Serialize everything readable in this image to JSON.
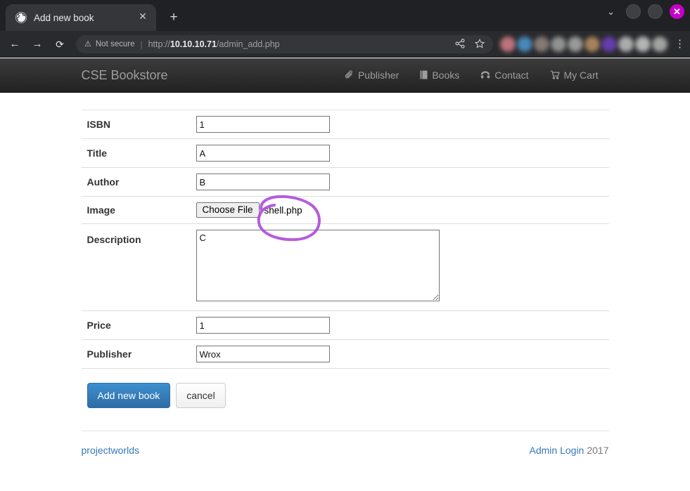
{
  "browser": {
    "tab": {
      "title": "Add new book",
      "favicon_icon": "globe-icon",
      "close_icon": "✕"
    },
    "new_tab_icon": "+",
    "window_controls": {
      "chevron_icon": "⌄",
      "minimize_icon": "",
      "maximize_icon": "",
      "close_icon": "✕"
    },
    "toolbar": {
      "back_icon": "←",
      "forward_icon": "→",
      "reload_icon": "⟳",
      "security_icon": "⚠",
      "security_label": "Not secure",
      "separator": "|",
      "url_scheme": "http://",
      "url_host": "10.10.10.71",
      "url_path": "/admin_add.php",
      "share_icon": "share-icon",
      "bookmark_icon": "★",
      "menu_icon": "⋮",
      "extension_colors": [
        "#c87b82",
        "#4a90c4",
        "#8d8179",
        "#9b9b9b",
        "#a3a3a3",
        "#b08a5e",
        "#6b3fb5",
        "#b8b8b8",
        "#c0c0c0",
        "#adadad"
      ]
    }
  },
  "site": {
    "brand": "CSE Bookstore",
    "nav": [
      {
        "label": "Publisher",
        "icon": "paperclip-icon"
      },
      {
        "label": "Books",
        "icon": "book-icon"
      },
      {
        "label": "Contact",
        "icon": "phone-icon"
      },
      {
        "label": "My Cart",
        "icon": "cart-icon"
      }
    ]
  },
  "form": {
    "fields": [
      {
        "label": "ISBN",
        "value": "1",
        "type": "text"
      },
      {
        "label": "Title",
        "value": "A",
        "type": "text"
      },
      {
        "label": "Author",
        "value": "B",
        "type": "text"
      }
    ],
    "image_row": {
      "label": "Image",
      "button_label": "Choose File",
      "filename": "shell.php"
    },
    "description_row": {
      "label": "Description",
      "value": "C"
    },
    "tail_fields": [
      {
        "label": "Price",
        "value": "1",
        "type": "text"
      },
      {
        "label": "Publisher",
        "value": "Wrox",
        "type": "text"
      }
    ],
    "submit_label": "Add new book",
    "cancel_label": "cancel"
  },
  "footer": {
    "left_link": "projectworlds",
    "right_link": "Admin Login",
    "year": "2017"
  },
  "annotation": {
    "shape": "hand-drawn-ellipse",
    "color": "#b14ddb",
    "target": "shell.php filename"
  }
}
